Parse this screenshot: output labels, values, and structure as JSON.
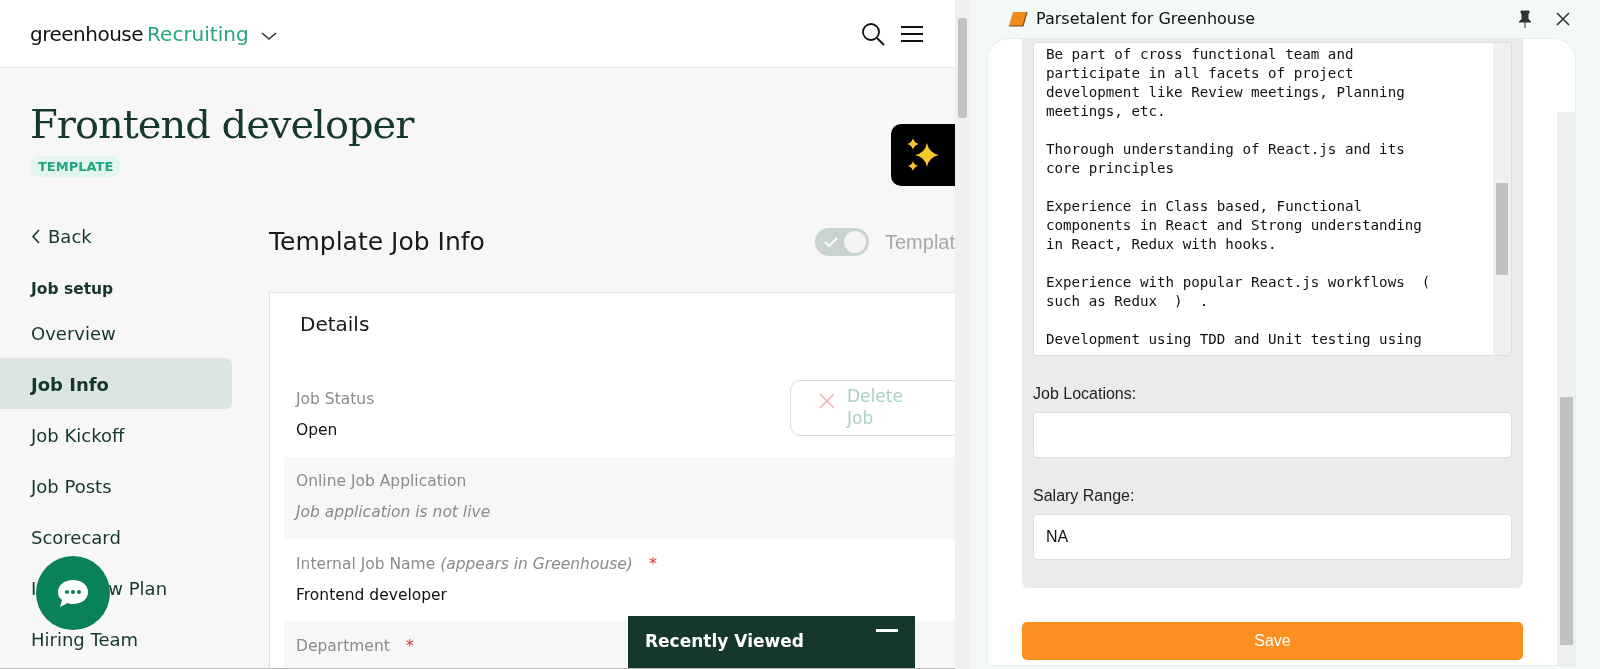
{
  "header": {
    "brand": "greenhouse",
    "product": "Recruiting"
  },
  "job": {
    "title": "Frontend developer",
    "badge": "TEMPLATE"
  },
  "sidebar": {
    "back": "Back",
    "section": "Job setup",
    "items": [
      {
        "label": "Overview",
        "selected": false
      },
      {
        "label": "Job Info",
        "selected": true
      },
      {
        "label": "Job Kickoff",
        "selected": false
      },
      {
        "label": "Job Posts",
        "selected": false
      },
      {
        "label": "Scorecard",
        "selected": false
      },
      {
        "label_parts": [
          "I",
          "w Plan"
        ],
        "selected": false
      },
      {
        "label": "Hiring Team",
        "selected": false
      }
    ]
  },
  "main": {
    "heading": "Template Job Info",
    "toggle": {
      "label": "Templat",
      "on": true
    },
    "details": {
      "title": "Details",
      "delete_button": "Delete Job",
      "fields": [
        {
          "label": "Job Status",
          "value": "Open",
          "kind": "value"
        },
        {
          "label": "Online Job Application",
          "value": "Job application is not live",
          "kind": "note"
        },
        {
          "label": "Internal Job Name *(appears in Greenhouse)*",
          "required_mark": "*",
          "value": "Frontend developer",
          "kind": "value"
        },
        {
          "label": "Department",
          "required_mark": "*",
          "kind": "value"
        }
      ]
    }
  },
  "recently_viewed": {
    "title": "Recently Viewed"
  },
  "panel": {
    "title": "Parsetalent for Greenhouse",
    "description": "Be part of cross functional team and\nparticipate in all facets of project\ndevelopment like Review meetings, Planning\nmeetings, etc.\n\nThorough understanding of React.js and its\ncore principles\n\nExperience in Class based, Functional\ncomponents in React and Strong understanding\nin React, Redux with hooks.\n\nExperience with popular React.js workflows  (\nsuch as Redux  )  .\n\nDevelopment using TDD and Unit testing using",
    "fields": [
      {
        "label": "Job Locations:"
      },
      {
        "label": "Salary Range:",
        "value": "NA"
      }
    ],
    "save_button": "Save"
  }
}
